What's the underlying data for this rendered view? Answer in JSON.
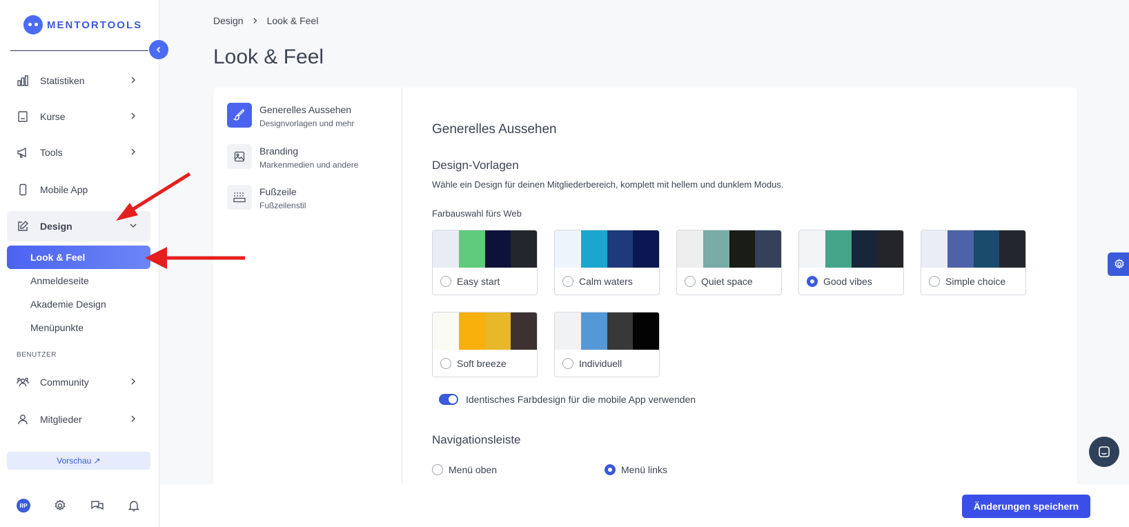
{
  "brand": {
    "name": "MENTORTOOLS",
    "accent": "#3b5bdb"
  },
  "sidebar": {
    "items": [
      {
        "label": "Statistiken",
        "icon": "bar-chart-icon"
      },
      {
        "label": "Kurse",
        "icon": "book-icon"
      },
      {
        "label": "Tools",
        "icon": "megaphone-icon"
      },
      {
        "label": "Mobile App",
        "icon": "phone-icon"
      },
      {
        "label": "Design",
        "icon": "pencil-square-icon"
      }
    ],
    "design_sub": [
      "Look & Feel",
      "Anmeldeseite",
      "Akademie Design",
      "Menüpunkte"
    ],
    "section_label": "BENUTZER",
    "user_items": [
      {
        "label": "Community",
        "icon": "users-icon"
      },
      {
        "label": "Mitglieder",
        "icon": "user-icon"
      }
    ],
    "preview_label": "Vorschau ↗",
    "avatar_initials": "RP"
  },
  "breadcrumb": {
    "parent": "Design",
    "current": "Look & Feel"
  },
  "page_title": "Look & Feel",
  "sub_nav": [
    {
      "title": "Generelles Aussehen",
      "subtitle": "Designvorlagen und mehr",
      "icon": "brush-icon"
    },
    {
      "title": "Branding",
      "subtitle": "Markenmedien und andere",
      "icon": "image-icon"
    },
    {
      "title": "Fußzeile",
      "subtitle": "Fußzeilenstil",
      "icon": "footer-icon"
    }
  ],
  "content": {
    "heading": "Generelles Aussehen",
    "design_heading": "Design-Vorlagen",
    "description": "Wähle ein Design für deinen Mitgliederbereich, komplett mit hellem und dunklem Modus.",
    "palette_label": "Farbauswahl fürs Web",
    "themes": [
      {
        "name": "Easy start",
        "colors": [
          "#e8ecf4",
          "#5fcb7d",
          "#0c1238",
          "#23262b"
        ],
        "selected": false
      },
      {
        "name": "Calm waters",
        "colors": [
          "#eef4fc",
          "#1aa6cf",
          "#1e3a7b",
          "#0c1650"
        ],
        "selected": false
      },
      {
        "name": "Quiet space",
        "colors": [
          "#eeeeee",
          "#79aba7",
          "#1a1c16",
          "#344159"
        ],
        "selected": false
      },
      {
        "name": "Good vibes",
        "colors": [
          "#f2f4f5",
          "#44a48a",
          "#172639",
          "#232528"
        ],
        "selected": true
      },
      {
        "name": "Simple choice",
        "colors": [
          "#eaedf5",
          "#4d62a8",
          "#1a4a6c",
          "#23272d"
        ],
        "selected": false
      },
      {
        "name": "Soft breeze",
        "colors": [
          "#f9faf4",
          "#f8b00e",
          "#e8b72a",
          "#3d3231"
        ],
        "selected": false
      },
      {
        "name": "Individuell",
        "colors": [
          "#f1f2f4",
          "#5598d6",
          "#383838",
          "#030303"
        ],
        "selected": false
      }
    ],
    "toggle_label": "Identisches Farbdesign für die mobile App verwenden",
    "toggle_on": true,
    "nav_heading": "Navigationsleiste",
    "nav_options": [
      {
        "label": "Menü oben",
        "selected": false
      },
      {
        "label": "Menü links",
        "selected": true
      }
    ]
  },
  "save_label": "Änderungen speichern"
}
